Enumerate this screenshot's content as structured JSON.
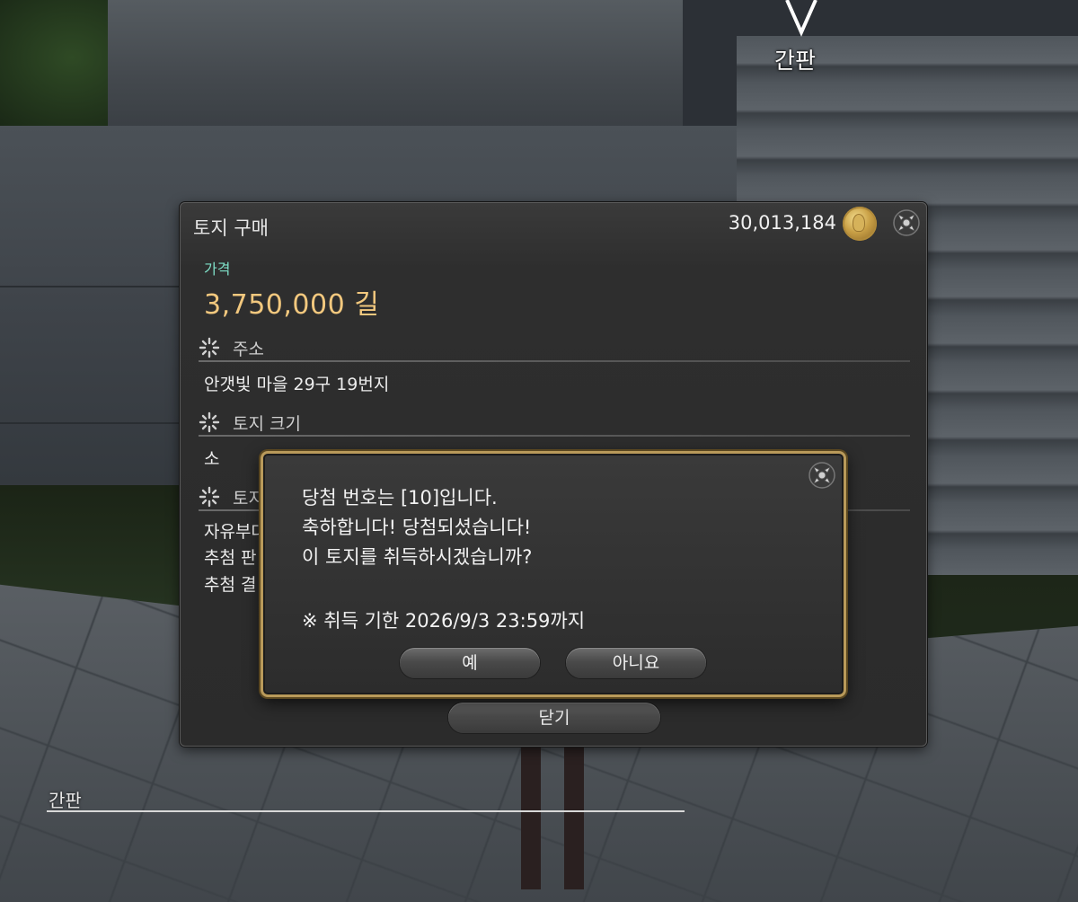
{
  "scene": {
    "nameplate_top": "간판",
    "sign_label": "간판"
  },
  "window": {
    "title": "토지 구매",
    "gil_amount": "30,013,184",
    "gil_icon": "gil-coin-icon",
    "close_icon": "close-icon",
    "price_label": "가격",
    "price_value": "3,750,000 길",
    "sections": [
      {
        "title": "주소",
        "values": [
          "안갯빛 마을 29구 19번지"
        ]
      },
      {
        "title": "토지 크기",
        "values": [
          "소"
        ]
      },
      {
        "title": "토지",
        "values": [
          "자유부대",
          "추첨 판",
          "추첨 결"
        ]
      }
    ],
    "close_button": "닫기"
  },
  "dialog": {
    "lines": [
      "당첨 번호는 [10]입니다.",
      "축하합니다! 당첨되셨습니다!",
      "이 토지를 취득하시겠습니까?",
      "※ 취득 기한 2026/9/3 23:59까지"
    ],
    "yes_button": "예",
    "no_button": "아니요"
  },
  "colors": {
    "price_label": "#7fe0c8",
    "price_value": "#f2c87e",
    "dialog_border": "#b99a5a"
  }
}
